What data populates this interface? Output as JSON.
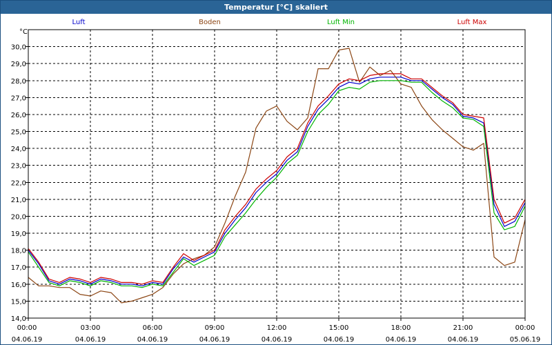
{
  "window": {
    "title": "Temperatur [°C] skaliert"
  },
  "colors": {
    "Luft": "#0000cc",
    "Boden": "#8b4513",
    "Luft Min": "#00b400",
    "Luft Max": "#cc0000",
    "grid": "#000000"
  },
  "chart_data": {
    "type": "line",
    "title": "Temperatur [°C] skaliert",
    "ylabel": "°C",
    "xlabel": "",
    "ylim": [
      14.0,
      31.0
    ],
    "xlim": [
      0,
      24
    ],
    "grid": true,
    "legend_position": "top",
    "y_ticks": [
      "14,0",
      "15,0",
      "16,0",
      "17,0",
      "18,0",
      "19,0",
      "20,0",
      "21,0",
      "22,0",
      "23,0",
      "24,0",
      "25,0",
      "26,0",
      "27,0",
      "28,0",
      "29,0",
      "30,0"
    ],
    "x_ticks": [
      {
        "time": "00:00",
        "date": "04.06.19"
      },
      {
        "time": "03:00",
        "date": "04.06.19"
      },
      {
        "time": "06:00",
        "date": "04.06.19"
      },
      {
        "time": "09:00",
        "date": "04.06.19"
      },
      {
        "time": "12:00",
        "date": "04.06.19"
      },
      {
        "time": "15:00",
        "date": "04.06.19"
      },
      {
        "time": "18:00",
        "date": "04.06.19"
      },
      {
        "time": "21:00",
        "date": "04.06.19"
      },
      {
        "time": "00:00",
        "date": "05.06.19"
      }
    ],
    "x_hours": [
      0,
      0.5,
      1,
      1.5,
      2,
      2.5,
      3,
      3.5,
      4,
      4.5,
      5,
      5.5,
      6,
      6.5,
      7,
      7.5,
      8,
      8.5,
      9,
      9.5,
      10,
      10.5,
      11,
      11.5,
      12,
      12.5,
      13,
      13.5,
      14,
      14.5,
      15,
      15.5,
      16,
      16.5,
      17,
      17.5,
      18,
      18.5,
      19,
      19.5,
      20,
      20.5,
      21,
      21.5,
      22,
      22.5,
      23,
      23.5,
      24
    ],
    "series": [
      {
        "name": "Luft",
        "values": [
          18.0,
          17.2,
          16.2,
          16.0,
          16.3,
          16.2,
          16.0,
          16.3,
          16.2,
          16.0,
          16.0,
          15.9,
          16.1,
          16.0,
          16.9,
          17.6,
          17.3,
          17.6,
          17.9,
          19.0,
          19.8,
          20.5,
          21.4,
          22.0,
          22.5,
          23.3,
          23.8,
          25.3,
          26.3,
          26.9,
          27.6,
          27.9,
          27.8,
          28.1,
          28.2,
          28.2,
          28.2,
          28.0,
          28.0,
          27.5,
          27.0,
          26.6,
          25.9,
          25.8,
          25.5,
          20.7,
          19.4,
          19.7,
          20.8
        ]
      },
      {
        "name": "Boden",
        "values": [
          16.4,
          15.9,
          15.9,
          15.8,
          15.8,
          15.4,
          15.3,
          15.6,
          15.5,
          14.9,
          15.0,
          15.2,
          15.4,
          15.8,
          16.6,
          17.2,
          17.5,
          17.7,
          18.2,
          19.6,
          21.2,
          22.6,
          25.2,
          26.2,
          26.5,
          25.6,
          25.1,
          25.8,
          28.7,
          28.7,
          29.8,
          29.9,
          27.9,
          28.8,
          28.3,
          28.6,
          27.8,
          27.6,
          26.5,
          25.7,
          25.1,
          24.6,
          24.1,
          23.9,
          24.3,
          17.6,
          17.1,
          17.3,
          19.8
        ]
      },
      {
        "name": "Luft Min",
        "values": [
          17.9,
          17.0,
          16.1,
          15.9,
          16.2,
          16.1,
          15.9,
          16.2,
          16.1,
          15.9,
          15.9,
          15.8,
          16.0,
          15.9,
          16.7,
          17.5,
          17.1,
          17.4,
          17.7,
          18.8,
          19.5,
          20.2,
          21.0,
          21.7,
          22.3,
          23.1,
          23.6,
          25.0,
          26.0,
          26.6,
          27.4,
          27.6,
          27.5,
          27.9,
          28.0,
          28.0,
          28.0,
          27.9,
          27.9,
          27.3,
          26.8,
          26.4,
          25.8,
          25.7,
          25.3,
          20.2,
          19.2,
          19.4,
          20.6
        ]
      },
      {
        "name": "Luft Max",
        "values": [
          18.1,
          17.3,
          16.3,
          16.1,
          16.4,
          16.3,
          16.1,
          16.4,
          16.3,
          16.1,
          16.1,
          16.0,
          16.2,
          16.1,
          17.0,
          17.8,
          17.4,
          17.7,
          18.0,
          19.2,
          20.0,
          20.7,
          21.6,
          22.2,
          22.7,
          23.5,
          24.0,
          25.5,
          26.5,
          27.1,
          27.8,
          28.1,
          28.0,
          28.3,
          28.4,
          28.4,
          28.4,
          28.1,
          28.1,
          27.6,
          27.1,
          26.7,
          26.0,
          25.9,
          25.8,
          21.0,
          19.6,
          19.9,
          21.0
        ]
      }
    ]
  }
}
